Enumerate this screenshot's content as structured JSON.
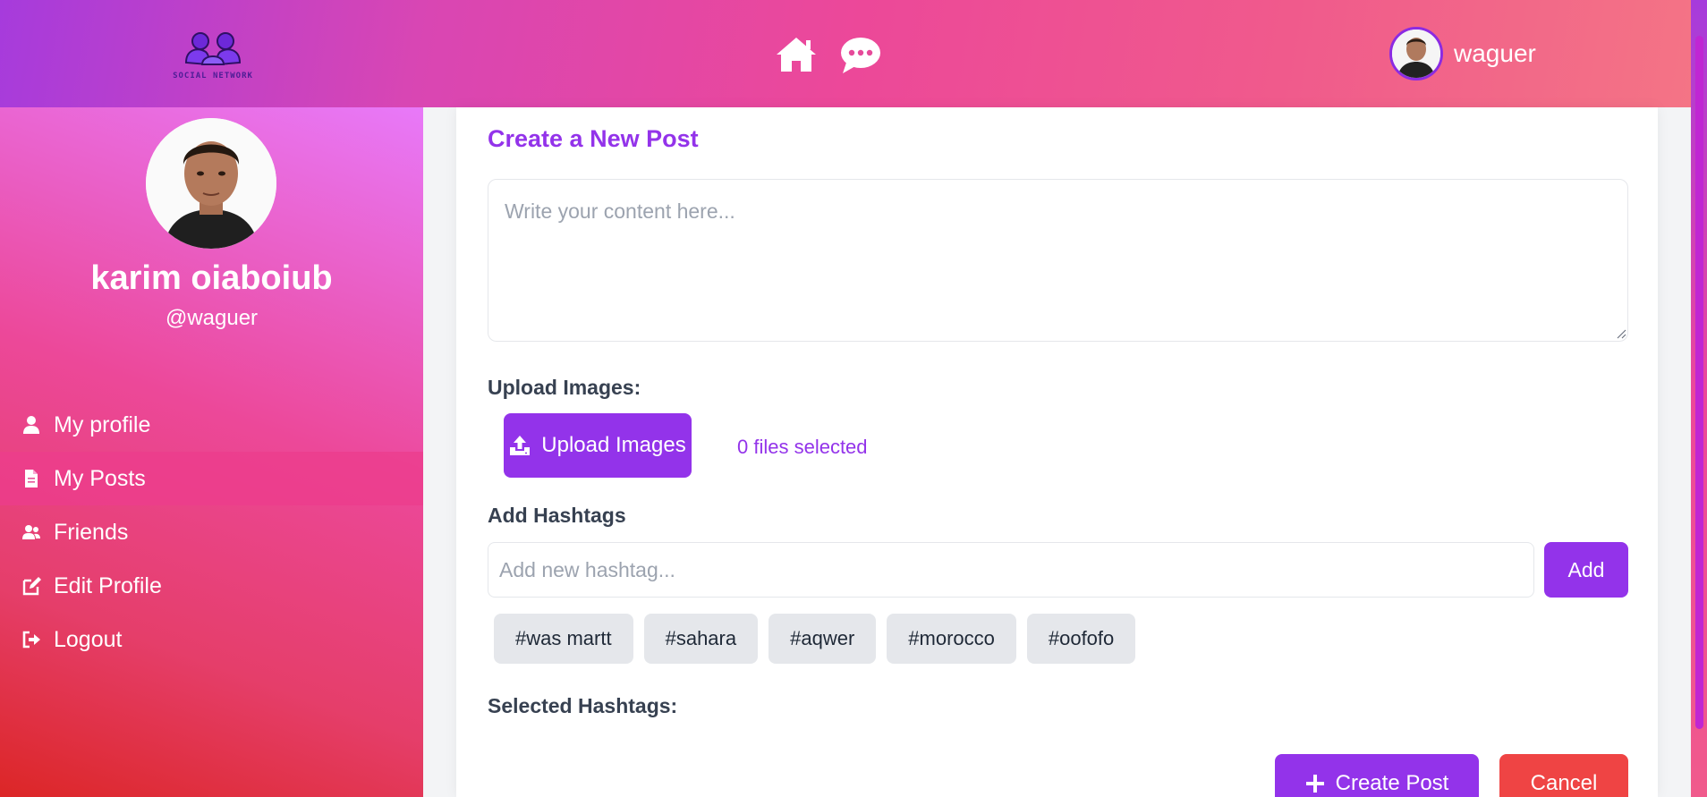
{
  "header": {
    "logo_text": "SOCIAL NETWORK",
    "nav": [
      {
        "icon": "home-icon"
      },
      {
        "icon": "chat-icon"
      }
    ],
    "username": "waguer"
  },
  "sidebar": {
    "profile_name": "karim oiaboiub",
    "profile_handle": "@waguer",
    "items": [
      {
        "label": "My profile",
        "icon": "user-icon"
      },
      {
        "label": "My Posts",
        "icon": "file-icon",
        "active": true
      },
      {
        "label": "Friends",
        "icon": "users-icon"
      },
      {
        "label": "Edit Profile",
        "icon": "edit-icon"
      },
      {
        "label": "Logout",
        "icon": "logout-icon"
      }
    ]
  },
  "post_form": {
    "title": "Create a New Post",
    "content_placeholder": "Write your content here...",
    "content_value": "",
    "upload_label": "Upload Images:",
    "upload_button": "Upload Images",
    "files_status": "0 files selected",
    "hashtags_label": "Add Hashtags",
    "hashtag_placeholder": "Add new hashtag...",
    "add_button": "Add",
    "suggested_hashtags": [
      "#was martt",
      "#sahara",
      "#aqwer",
      "#morocco",
      "#oofofo"
    ],
    "selected_label": "Selected Hashtags:",
    "create_button": "Create Post",
    "cancel_button": "Cancel"
  },
  "colors": {
    "accent": "#9333ea",
    "danger": "#ef4444",
    "tag_bg": "#e5e7eb"
  }
}
